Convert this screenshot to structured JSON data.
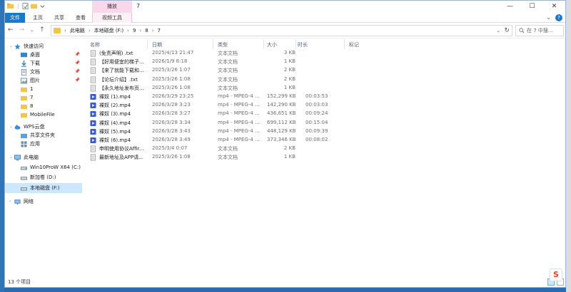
{
  "window": {
    "title": "7",
    "context_tab_header": "播放",
    "controls": {
      "minimize": "—",
      "maximize": "☐",
      "close": "✕"
    }
  },
  "ribbon": {
    "tabs": [
      "文件",
      "主页",
      "共享",
      "查看",
      "视频工具"
    ],
    "help": "?"
  },
  "address": {
    "crumbs": [
      "此电脑",
      "本地磁盘 (F:)",
      "9",
      "8",
      "7"
    ],
    "search_placeholder": "在 7 中搜..."
  },
  "nav_pane": {
    "quick_access": {
      "label": "快速访问",
      "items": [
        "桌面",
        "下载",
        "文档",
        "图片",
        "1",
        "7",
        "8",
        "MobileFile"
      ]
    },
    "wps": {
      "label": "WPS云盘",
      "items": [
        "共享文件夹",
        "应用"
      ]
    },
    "this_pc": {
      "label": "此电脑",
      "items": [
        "Win10ProW X64 (C:)",
        "新加卷 (D:)",
        "本地磁盘 (F:)"
      ]
    },
    "network": "网络"
  },
  "columns": [
    "名称",
    "日期",
    "类型",
    "大小",
    "时长",
    "标记"
  ],
  "files": [
    {
      "name": "(免责声明) .txt",
      "date": "2025/4/13 21:47",
      "type": "文本文档",
      "size": "3 KB",
      "duration": "",
      "icon": "txt"
    },
    {
      "name": "【好用便宜的梯子...",
      "date": "2026/1/9 8:18",
      "type": "文本文档",
      "size": "1 KB",
      "duration": "",
      "icon": "txt"
    },
    {
      "name": "【来了就能下载和...",
      "date": "2025/3/26 1:07",
      "type": "文本文档",
      "size": "2 KB",
      "duration": "",
      "icon": "txt"
    },
    {
      "name": "【论坛介绍】.txt",
      "date": "2025/3/26 1:08",
      "type": "文本文档",
      "size": "2 KB",
      "duration": "",
      "icon": "txt"
    },
    {
      "name": "【永久地址发布页...",
      "date": "2025/3/26 1:08",
      "type": "文本文档",
      "size": "1 KB",
      "duration": "",
      "icon": "txt"
    },
    {
      "name": "裸奴 (1).mp4",
      "date": "2026/3/29 23:25",
      "type": "mp4 - MPEG-4 ...",
      "size": "152,299 KB",
      "duration": "00:03:53",
      "icon": "mp4"
    },
    {
      "name": "裸奴 (2).mp4",
      "date": "2026/3/28 3:23",
      "type": "mp4 - MPEG-4 ...",
      "size": "142,290 KB",
      "duration": "00:03:03",
      "icon": "mp4"
    },
    {
      "name": "裸奴 (3).mp4",
      "date": "2026/3/28 3:27",
      "type": "mp4 - MPEG-4 ...",
      "size": "436,651 KB",
      "duration": "00:09:24",
      "icon": "mp4"
    },
    {
      "name": "裸奴 (4).mp4",
      "date": "2026/3/28 3:34",
      "type": "mp4 - MPEG-4 ...",
      "size": "699,112 KB",
      "duration": "00:15:04",
      "icon": "mp4"
    },
    {
      "name": "裸奴 (5).mp4",
      "date": "2026/3/28 3:43",
      "type": "mp4 - MPEG-4 ...",
      "size": "448,129 KB",
      "duration": "00:09:39",
      "icon": "mp4"
    },
    {
      "name": "裸奴 (6).mp4",
      "date": "2026/3/28 3:49",
      "type": "mp4 - MPEG-4 ...",
      "size": "373,346 KB",
      "duration": "00:08:02",
      "icon": "mp4"
    },
    {
      "name": "申明使用协议Affir...",
      "date": "2025/3/4 0:07",
      "type": "文本文档",
      "size": "2 KB",
      "duration": "",
      "icon": "txt"
    },
    {
      "name": "最新地址及APP请...",
      "date": "2025/3/26 1:08",
      "type": "文本文档",
      "size": "1 KB",
      "duration": "",
      "icon": "txt"
    }
  ],
  "status": {
    "count": "13 个项目"
  },
  "tray": {
    "ime": "S"
  }
}
